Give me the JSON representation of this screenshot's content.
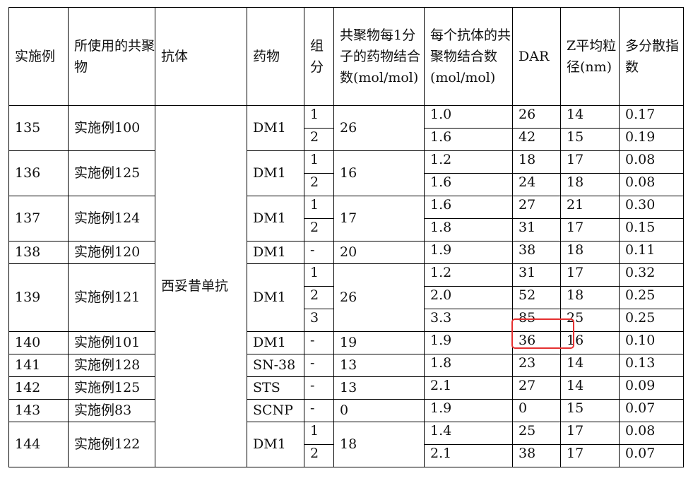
{
  "headers": {
    "example": "实施例",
    "polymer": "所使用的共聚物",
    "antibody": "抗体",
    "drug": "药物",
    "group": "组分",
    "drug_per_polymer": "共聚物每1分子的药物结合数(mol/mol)",
    "polymer_per_antibody": "每个抗体的共聚物结合数(mol/mol)",
    "dar": "DAR",
    "z_avg": "Z平均粒径(nm)",
    "pdi": "多分散指数"
  },
  "antibody_name": "西妥昔单抗",
  "groups": [
    {
      "example": "135",
      "polymer": "实施例100",
      "drug": "DM1",
      "drug_per_polymer": "26",
      "rows": [
        {
          "group": "1",
          "polymer_per_antibody": "1.0",
          "dar": "26",
          "z_avg": "14",
          "pdi": "0.17"
        },
        {
          "group": "2",
          "polymer_per_antibody": "1.6",
          "dar": "42",
          "z_avg": "15",
          "pdi": "0.19"
        }
      ]
    },
    {
      "example": "136",
      "polymer": "实施例125",
      "drug": "DM1",
      "drug_per_polymer": "16",
      "rows": [
        {
          "group": "1",
          "polymer_per_antibody": "1.2",
          "dar": "18",
          "z_avg": "17",
          "pdi": "0.08"
        },
        {
          "group": "2",
          "polymer_per_antibody": "1.6",
          "dar": "24",
          "z_avg": "18",
          "pdi": "0.08"
        }
      ]
    },
    {
      "example": "137",
      "polymer": "实施例124",
      "drug": "DM1",
      "drug_per_polymer": "17",
      "rows": [
        {
          "group": "1",
          "polymer_per_antibody": "1.6",
          "dar": "27",
          "z_avg": "21",
          "pdi": "0.30"
        },
        {
          "group": "2",
          "polymer_per_antibody": "1.8",
          "dar": "31",
          "z_avg": "17",
          "pdi": "0.15"
        }
      ]
    },
    {
      "example": "138",
      "polymer": "实施例120",
      "drug": "DM1",
      "drug_per_polymer": "20",
      "rows": [
        {
          "group": "-",
          "polymer_per_antibody": "1.9",
          "dar": "38",
          "z_avg": "18",
          "pdi": "0.11"
        }
      ]
    },
    {
      "example": "139",
      "polymer": "实施例121",
      "drug": "DM1",
      "drug_per_polymer": "26",
      "rows": [
        {
          "group": "1",
          "polymer_per_antibody": "1.2",
          "dar": "31",
          "z_avg": "17",
          "pdi": "0.32"
        },
        {
          "group": "2",
          "polymer_per_antibody": "2.0",
          "dar": "52",
          "z_avg": "18",
          "pdi": "0.25"
        },
        {
          "group": "3",
          "polymer_per_antibody": "3.3",
          "dar": "85",
          "z_avg": "25",
          "pdi": "0.25"
        }
      ]
    },
    {
      "example": "140",
      "polymer": "实施例101",
      "drug": "DM1",
      "drug_per_polymer": "19",
      "rows": [
        {
          "group": "-",
          "polymer_per_antibody": "1.9",
          "dar": "36",
          "z_avg": "16",
          "pdi": "0.10"
        }
      ]
    },
    {
      "example": "141",
      "polymer": "实施例128",
      "drug": "SN-38",
      "drug_per_polymer": "13",
      "rows": [
        {
          "group": "-",
          "polymer_per_antibody": "1.8",
          "dar": "23",
          "z_avg": "14",
          "pdi": "0.13"
        }
      ]
    },
    {
      "example": "142",
      "polymer": "实施例125",
      "drug": "STS",
      "drug_per_polymer": "13",
      "rows": [
        {
          "group": "-",
          "polymer_per_antibody": "2.1",
          "dar": "27",
          "z_avg": "14",
          "pdi": "0.09"
        }
      ]
    },
    {
      "example": "143",
      "polymer": "实施例83",
      "drug": "SCNP",
      "drug_per_polymer": "0",
      "rows": [
        {
          "group": "-",
          "polymer_per_antibody": "1.9",
          "dar": "0",
          "z_avg": "15",
          "pdi": "0.07"
        }
      ]
    },
    {
      "example": "144",
      "polymer": "实施例122",
      "drug": "DM1",
      "drug_per_polymer": "18",
      "rows": [
        {
          "group": "1",
          "polymer_per_antibody": "1.4",
          "dar": "25",
          "z_avg": "17",
          "pdi": "0.08"
        },
        {
          "group": "2",
          "polymer_per_antibody": "2.1",
          "dar": "38",
          "z_avg": "17",
          "pdi": "0.07"
        }
      ]
    }
  ],
  "highlight_color": "#e53030"
}
